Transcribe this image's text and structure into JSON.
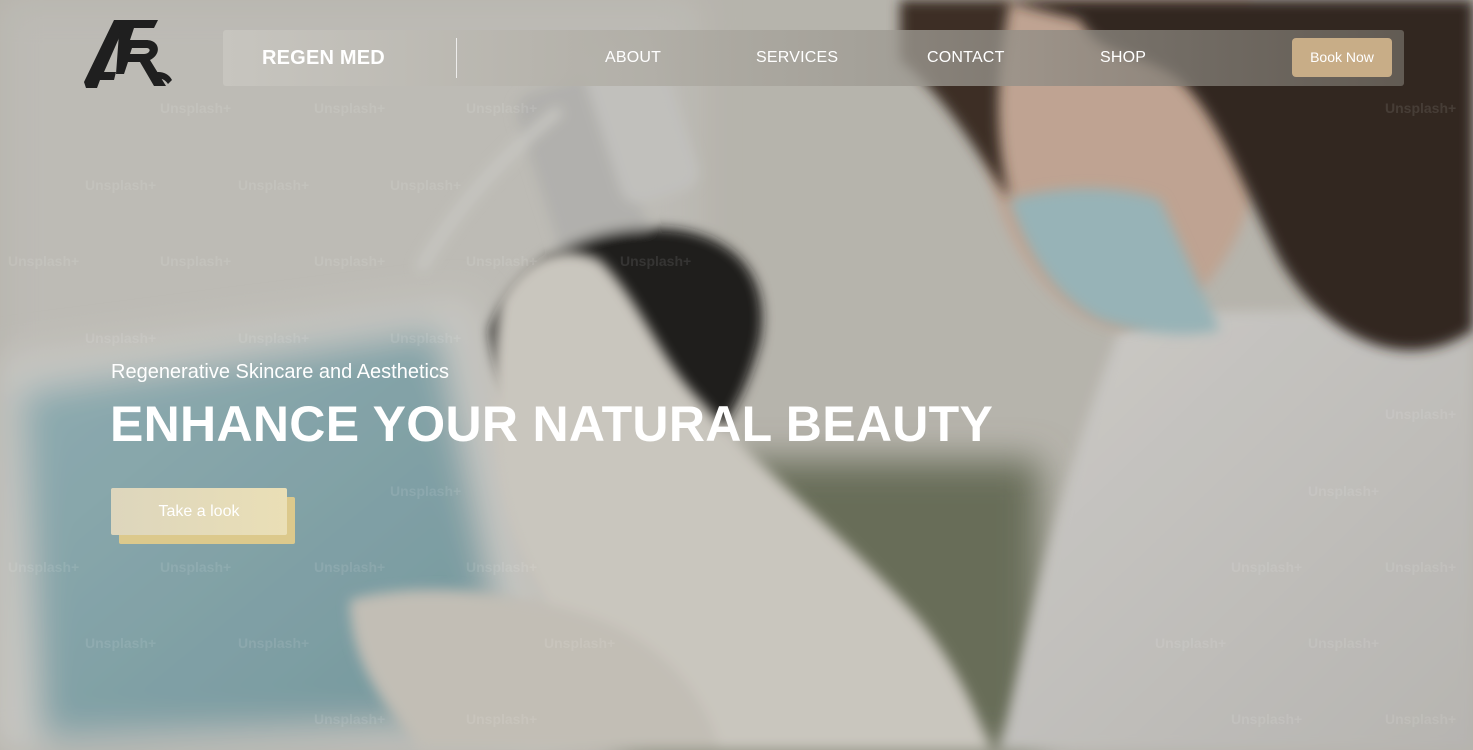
{
  "header": {
    "brand": "REGEN MED",
    "nav": [
      {
        "label": "ABOUT"
      },
      {
        "label": "SERVICES"
      },
      {
        "label": "CONTACT"
      },
      {
        "label": "SHOP"
      }
    ],
    "book_label": "Book Now"
  },
  "hero": {
    "subtitle": "Regenerative Skincare and Aesthetics",
    "headline": "ENHANCE YOUR NATURAL BEAUTY",
    "cta_label": "Take a look",
    "watermark": "Unsplash+"
  },
  "colors": {
    "accent": "#c8ad87",
    "cta_gold": "#dcc98c",
    "text": "#ffffff"
  }
}
